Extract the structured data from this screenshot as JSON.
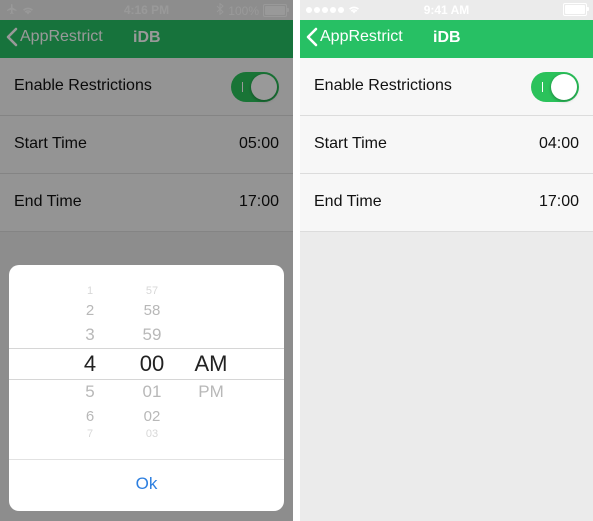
{
  "left_screen": {
    "status_bar": {
      "time": "4:16 PM",
      "battery": "100%",
      "airplane_icon": "airplane-icon",
      "wifi_icon": "wifi-icon",
      "bluetooth_icon": "bluetooth-icon"
    },
    "nav": {
      "back_label": "AppRestrict",
      "title": "iDB"
    },
    "rows": {
      "enable_label": "Enable Restrictions",
      "enable_state": true,
      "start_label": "Start Time",
      "start_value": "05:00",
      "end_label": "End Time",
      "end_value": "17:00"
    },
    "picker": {
      "hours": [
        "1",
        "2",
        "3",
        "4",
        "5",
        "6",
        "7"
      ],
      "minutes": [
        "57",
        "58",
        "59",
        "00",
        "01",
        "02",
        "03"
      ],
      "selected_hour": "4",
      "selected_minute": "00",
      "periods": [
        "AM",
        "PM"
      ],
      "selected_period": "AM",
      "ok_label": "Ok"
    }
  },
  "right_screen": {
    "status_bar": {
      "time": "9:41 AM",
      "wifi_icon": "wifi-icon"
    },
    "nav": {
      "back_label": "AppRestrict",
      "title": "iDB"
    },
    "rows": {
      "enable_label": "Enable Restrictions",
      "enable_state": true,
      "start_label": "Start Time",
      "start_value": "04:00",
      "end_label": "End Time",
      "end_value": "17:00"
    }
  },
  "colors": {
    "nav_green": "#27c064",
    "toggle_green": "#2bc25b",
    "ok_blue": "#2d7fe0"
  }
}
